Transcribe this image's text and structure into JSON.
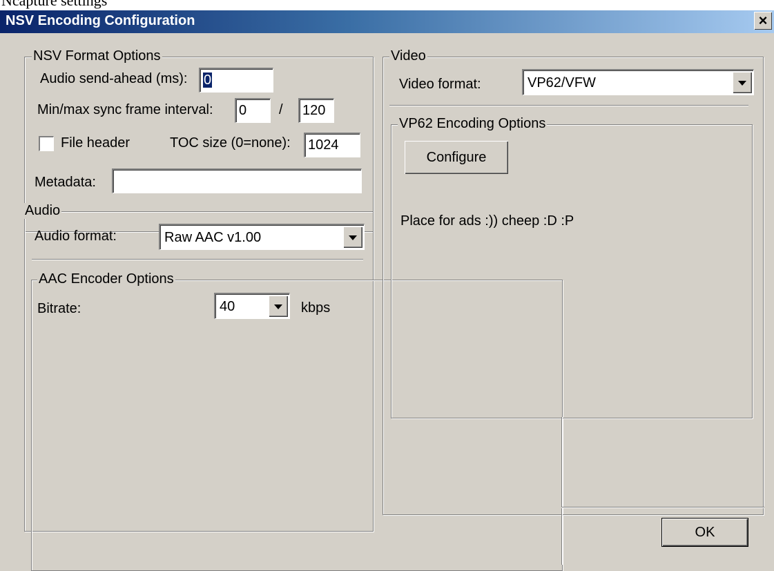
{
  "window": {
    "top_text": "Ncapture settings",
    "title": "NSV Encoding Configuration",
    "close_glyph": "×"
  },
  "nsv": {
    "legend": "NSV Format Options",
    "send_ahead_label": "Audio send-ahead (ms):",
    "send_ahead_value": "0",
    "sync_label": "Min/max sync frame interval:",
    "sync_min": "0",
    "sync_sep": "/",
    "sync_max": "120",
    "file_header_label": "File header",
    "file_header_checked": false,
    "toc_label": "TOC size (0=none):",
    "toc_value": "1024",
    "metadata_label": "Metadata:",
    "metadata_value": ""
  },
  "audio": {
    "legend": "Audio",
    "format_label": "Audio format:",
    "format_value": "Raw AAC v1.00"
  },
  "aac": {
    "legend": "AAC Encoder Options",
    "bitrate_label": "Bitrate:",
    "bitrate_value": "40",
    "unit": "kbps"
  },
  "video": {
    "legend": "Video",
    "format_label": "Video format:",
    "format_value": "VP62/VFW"
  },
  "vp62": {
    "legend": "VP62 Encoding Options",
    "configure_label": "Configure",
    "ad_text": "Place for ads :))  cheep  :D :P"
  },
  "footer": {
    "ok_label": "OK"
  },
  "colors": {
    "face": "#d4d0c8",
    "title_start": "#0a246a",
    "title_end": "#a6caf0"
  }
}
